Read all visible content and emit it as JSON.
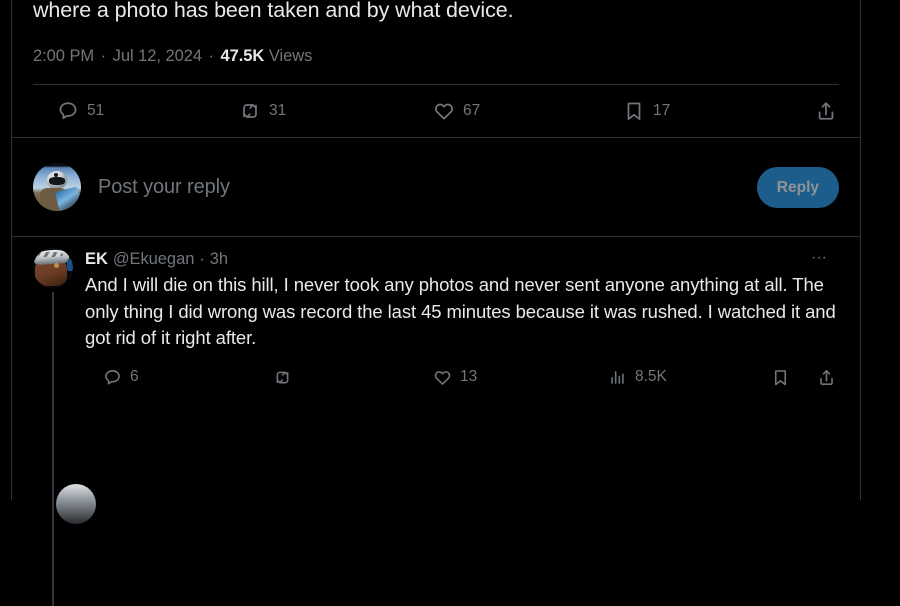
{
  "app": {
    "name": "X",
    "theme": "dark",
    "background_color": "#000000",
    "border_color": "#2f3336",
    "text_primary_color": "#e7e9ea",
    "text_secondary_color": "#71767b",
    "accent_color": "#1d9bf0"
  },
  "focus_post": {
    "text_tail": "where a photo has been taken and by what device.",
    "timestamp_time": "2:00 PM",
    "separator": "·",
    "timestamp_date": "Jul 12, 2024",
    "views_count": "47.5K",
    "views_label": "Views",
    "actions": {
      "reply": {
        "icon": "reply-icon",
        "count": "51"
      },
      "repost": {
        "icon": "repost-icon",
        "count": "31"
      },
      "like": {
        "icon": "like-icon",
        "count": "67"
      },
      "bookmark": {
        "icon": "bookmark-icon",
        "count": "17"
      },
      "share": {
        "icon": "share-icon",
        "count": ""
      }
    }
  },
  "composer": {
    "avatar_alt": "pilot-avatar",
    "placeholder": "Post your reply",
    "reply_button_label": "Reply",
    "reply_button_color": "#1c5d8c",
    "reply_button_text_color": "#8e9497",
    "reply_button_enabled": false
  },
  "replies": [
    {
      "avatar_alt": "ekuegan-avatar",
      "display_name": "EK",
      "handle": "@Ekuegan",
      "separator": "·",
      "time_ago": "3h",
      "more_label": "···",
      "text": "And I will die on this hill, I never took any photos and never sent anyone anything at all. The only thing I did wrong was record the last 45 minutes because it was rushed. I watched it and got rid of it right after.",
      "actions": {
        "reply": {
          "icon": "reply-icon",
          "count": "6"
        },
        "repost": {
          "icon": "repost-icon",
          "count": ""
        },
        "like": {
          "icon": "like-icon",
          "count": "13"
        },
        "views": {
          "icon": "views-icon",
          "count": "8.5K"
        },
        "bookmark": {
          "icon": "bookmark-icon",
          "count": ""
        },
        "share": {
          "icon": "share-icon",
          "count": ""
        }
      }
    }
  ],
  "next_reply_peek": {
    "avatar_alt": "next-reply-avatar"
  }
}
